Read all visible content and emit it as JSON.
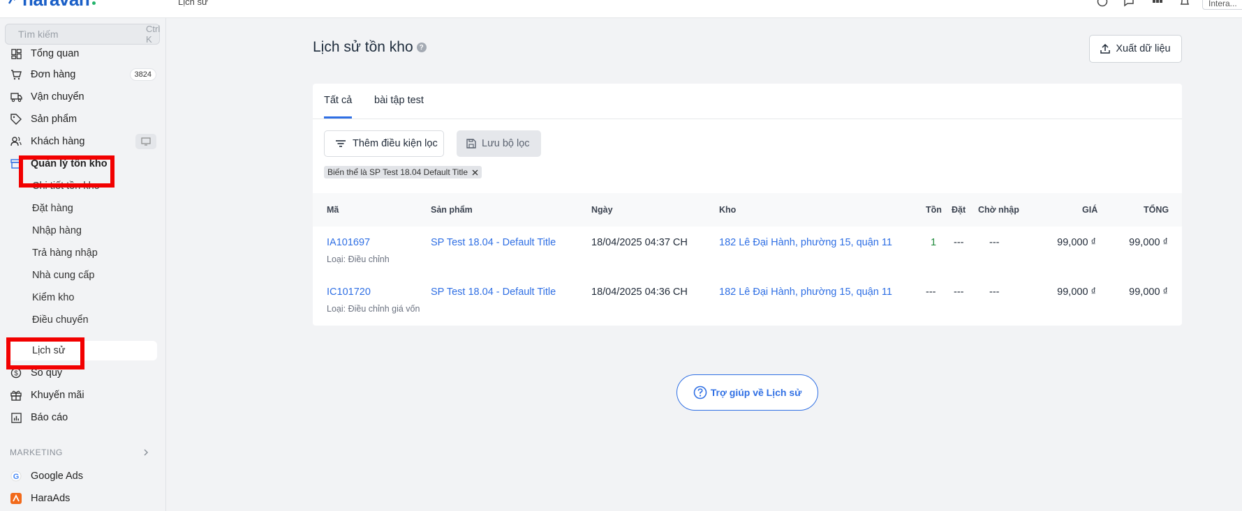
{
  "topbar": {
    "brand": "haravan",
    "breadcrumb": "Lịch sử",
    "store_label": "Intera..."
  },
  "sidebar": {
    "search_placeholder": "Tìm kiếm",
    "search_shortcut": "Ctrl K",
    "items": [
      {
        "label": "Tổng quan",
        "icon": "dashboard-icon"
      },
      {
        "label": "Đơn hàng",
        "icon": "cart-icon",
        "badge": "3824"
      },
      {
        "label": "Vận chuyển",
        "icon": "truck-icon"
      },
      {
        "label": "Sản phẩm",
        "icon": "tag-icon"
      },
      {
        "label": "Khách hàng",
        "icon": "users-icon"
      },
      {
        "label": "Quản lý tồn kho",
        "icon": "inventory-icon"
      }
    ],
    "sub_items": [
      "Chi tiết tồn kho",
      "Đặt hàng",
      "Nhập hàng",
      "Trả hàng nhập",
      "Nhà cung cấp",
      "Kiểm kho",
      "Điều chuyển",
      "Lịch sử"
    ],
    "items_after": [
      {
        "label": "Sổ quỹ",
        "icon": "dollar-icon"
      },
      {
        "label": "Khuyến mãi",
        "icon": "gift-icon"
      },
      {
        "label": "Báo cáo",
        "icon": "report-icon"
      }
    ],
    "section_label": "MARKETING",
    "marketing": [
      {
        "label": "Google Ads",
        "icon": "google-icon"
      },
      {
        "label": "HaraAds",
        "icon": "haraads-icon"
      }
    ]
  },
  "page": {
    "title": "Lịch sử tồn kho",
    "export_label": "Xuất dữ liệu",
    "tabs": [
      "Tất cả",
      "bài tập test"
    ],
    "filter_label": "Thêm điều kiện lọc",
    "save_filter_label": "Lưu bộ lọc",
    "chip_label": "Biến thể là SP Test 18.04 Default Title",
    "help_label": "Trợ giúp về Lịch sử"
  },
  "table": {
    "columns": [
      "Mã",
      "Sản phẩm",
      "Ngày",
      "Kho",
      "Tồn",
      "Đặt",
      "Chờ nhập",
      "GIÁ",
      "TỔNG"
    ],
    "rows": [
      {
        "code": "IA101697",
        "type": "Loại: Điều chỉnh",
        "product": "SP Test 18.04 - Default Title",
        "date": "18/04/2025 04:37 CH",
        "warehouse": "182 Lê Đại Hành, phường 15, quận 11",
        "ton": "1",
        "dat": "---",
        "cho_nhap": "---",
        "price": "99,000 ₫",
        "total": "99,000 ₫"
      },
      {
        "code": "IC101720",
        "type": "Loại: Điều chỉnh giá vốn",
        "product": "SP Test 18.04 - Default Title",
        "date": "18/04/2025 04:36 CH",
        "warehouse": "182 Lê Đại Hành, phường 15, quận 11",
        "ton": "---",
        "dat": "---",
        "cho_nhap": "---",
        "price": "99,000 ₫",
        "total": "99,000 ₫"
      }
    ]
  },
  "colors": {
    "accent": "#2f6fe4",
    "highlight": "#f20000",
    "positive": "#1f8a3b"
  }
}
